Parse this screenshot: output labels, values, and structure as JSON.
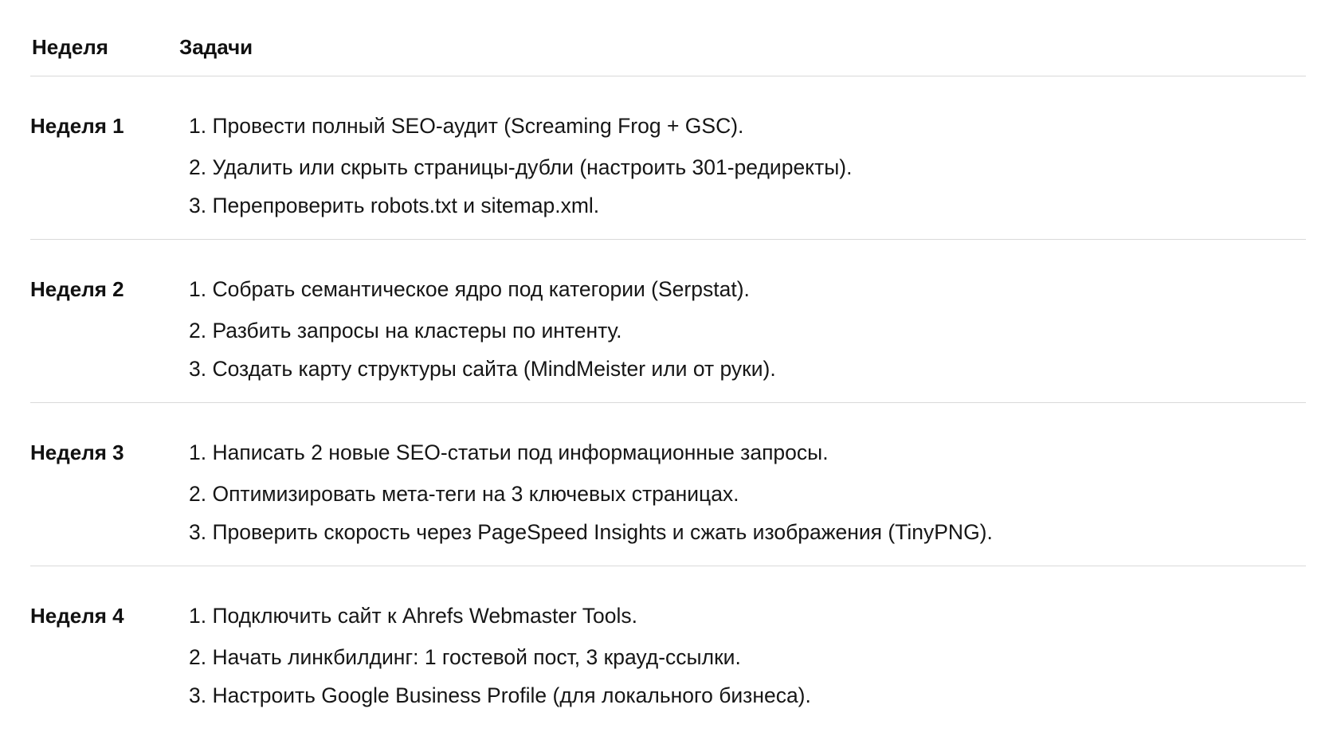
{
  "table": {
    "header": {
      "week": "Неделя",
      "tasks": "Задачи"
    },
    "weeks": [
      {
        "label": "Неделя 1",
        "tasks": [
          "1. Провести полный SEO-аудит (Screaming Frog + GSC).",
          "2. Удалить или скрыть страницы-дубли (настроить 301-редиректы).",
          "3. Перепроверить robots.txt и sitemap.xml."
        ]
      },
      {
        "label": "Неделя 2",
        "tasks": [
          "1. Собрать семантическое ядро под категории (Serpstat).",
          "2. Разбить запросы на кластеры по интенту.",
          "3. Создать карту структуры сайта (MindMeister или от руки)."
        ]
      },
      {
        "label": "Неделя 3",
        "tasks": [
          "1. Написать 2 новые SEO-статьи под информационные запросы.",
          "2. Оптимизировать мета-теги на 3 ключевых страницах.",
          "3. Проверить скорость через PageSpeed Insights и сжать изображения (TinyPNG)."
        ]
      },
      {
        "label": "Неделя 4",
        "tasks": [
          "1. Подключить сайт к Ahrefs Webmaster Tools.",
          "2. Начать линкбилдинг: 1 гостевой пост, 3 крауд-ссылки.",
          "3. Настроить Google Business Profile (для локального бизнеса)."
        ]
      }
    ]
  }
}
